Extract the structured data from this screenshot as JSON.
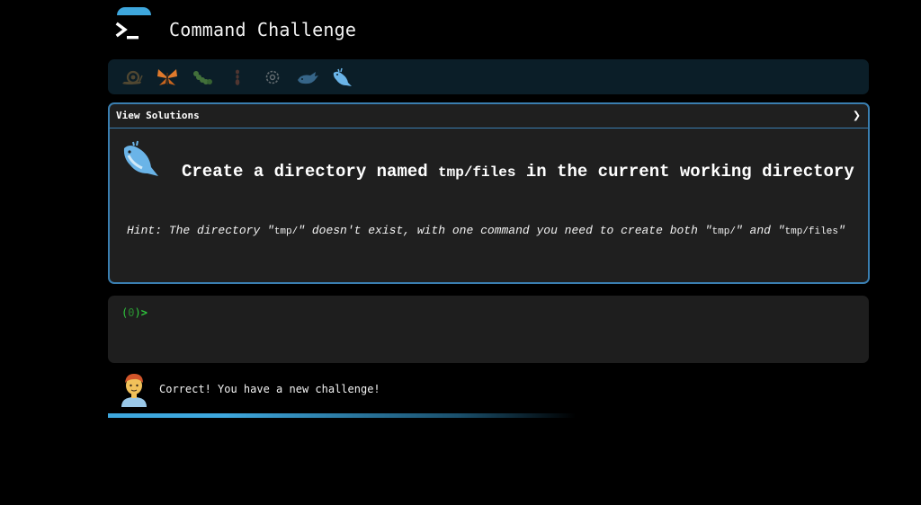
{
  "app": {
    "title": "Command Challenge",
    "logo_icon": "terminal-prompt-icon",
    "accent": "#3ea7dd"
  },
  "badges": [
    {
      "icon": "snail-icon",
      "color": "#8a6a3a",
      "active": false
    },
    {
      "icon": "butterfly-icon",
      "color": "#e07a2c",
      "active": true
    },
    {
      "icon": "caterpillar-icon",
      "color": "#6fb34a",
      "active": false
    },
    {
      "icon": "ant-icon",
      "color": "#8a4a3a",
      "active": false
    },
    {
      "icon": "gear-flower-icon",
      "color": "#aaaaaa",
      "active": false
    },
    {
      "icon": "whale-icon",
      "color": "#5aa0d8",
      "active": false
    },
    {
      "icon": "spouting-whale-icon",
      "color": "#6ab4e8",
      "active": true
    }
  ],
  "challenge": {
    "solutions_label": "View Solutions",
    "icon": "spouting-whale-icon",
    "question_pre": "Create a directory named ",
    "question_code": "tmp/files",
    "question_post": " in the current working directory",
    "hint_pre": "Hint: The directory \"",
    "hint_code1": "tmp/",
    "hint_mid": "\" doesn't exist, with one command you need to create both \"",
    "hint_code2": "tmp/",
    "hint_mid2": "\" and \"",
    "hint_code3": "tmp/files",
    "hint_post": "\""
  },
  "terminal": {
    "prompt_open": "(",
    "prompt_count": "0",
    "prompt_close": ")",
    "prompt_arrow": ">",
    "input_value": ""
  },
  "feedback": {
    "avatar_icon": "person-avatar-icon",
    "message": "Correct! You have a new challenge!"
  },
  "progress": {
    "fraction": 0.5
  }
}
